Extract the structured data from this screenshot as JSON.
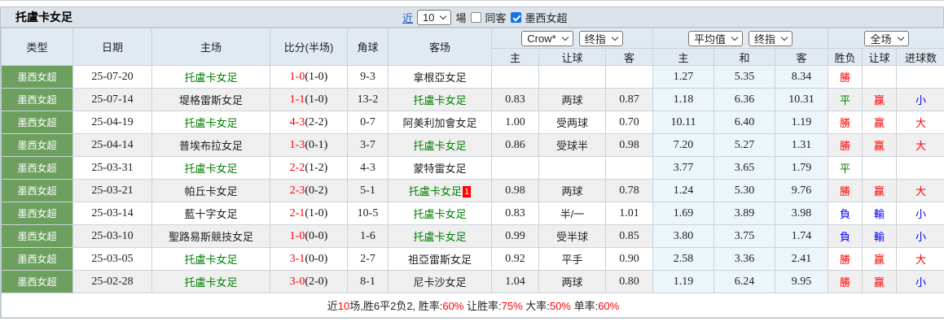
{
  "header": {
    "title": "托盧卡女足",
    "recent_label": "近",
    "recent_count": "10",
    "unit_label": "場",
    "same_away_label": "同客",
    "same_away_checked": false,
    "league_filter_label": "墨西女超",
    "league_filter_checked": true
  },
  "selectors": {
    "bookmaker": "Crow*",
    "bookmaker_stage": "终指",
    "average": "平均值",
    "average_stage": "终指",
    "scope": "全场"
  },
  "columns": {
    "main": [
      "类型",
      "日期",
      "主场",
      "比分(半场)",
      "角球",
      "客场"
    ],
    "sub": [
      "主",
      "让球",
      "客",
      "主",
      "和",
      "客",
      "胜负",
      "让球",
      "进球数"
    ]
  },
  "rows": [
    {
      "league": "墨西女超",
      "date": "25-07-20",
      "home": "托盧卡女足",
      "home_green": true,
      "score_full": "1-0",
      "score_half": "(1-0)",
      "corner": "9-3",
      "away": "拿根亞女足",
      "away_green": false,
      "away_badge": "",
      "odds": [
        "",
        "",
        ""
      ],
      "avg": [
        "1.27",
        "5.35",
        "8.34"
      ],
      "results": [
        {
          "text": "勝",
          "color": "#ff0000"
        },
        {
          "text": "",
          "color": ""
        },
        {
          "text": "",
          "color": ""
        }
      ]
    },
    {
      "league": "墨西女超",
      "date": "25-07-14",
      "home": "堤格雷斯女足",
      "home_green": false,
      "score_full": "1-1",
      "score_half": "(1-0)",
      "corner": "13-2",
      "away": "托盧卡女足",
      "away_green": true,
      "away_badge": "",
      "odds": [
        "0.83",
        "两球",
        "0.87"
      ],
      "avg": [
        "1.18",
        "6.36",
        "10.31"
      ],
      "results": [
        {
          "text": "平",
          "color": "#008000"
        },
        {
          "text": "赢",
          "color": "#ff0000"
        },
        {
          "text": "小",
          "color": "#0000ff"
        }
      ]
    },
    {
      "league": "墨西女超",
      "date": "25-04-19",
      "home": "托盧卡女足",
      "home_green": true,
      "score_full": "4-3",
      "score_half": "(2-2)",
      "corner": "0-7",
      "away": "阿美利加會女足",
      "away_green": false,
      "away_badge": "",
      "odds": [
        "1.00",
        "受两球",
        "0.70"
      ],
      "avg": [
        "10.11",
        "6.40",
        "1.19"
      ],
      "results": [
        {
          "text": "勝",
          "color": "#ff0000"
        },
        {
          "text": "赢",
          "color": "#ff0000"
        },
        {
          "text": "大",
          "color": "#ff0000"
        }
      ]
    },
    {
      "league": "墨西女超",
      "date": "25-04-14",
      "home": "普埃布拉女足",
      "home_green": false,
      "score_full": "1-3",
      "score_half": "(0-1)",
      "corner": "3-7",
      "away": "托盧卡女足",
      "away_green": true,
      "away_badge": "",
      "odds": [
        "0.86",
        "受球半",
        "0.98"
      ],
      "avg": [
        "7.20",
        "5.27",
        "1.31"
      ],
      "results": [
        {
          "text": "勝",
          "color": "#ff0000"
        },
        {
          "text": "赢",
          "color": "#ff0000"
        },
        {
          "text": "大",
          "color": "#ff0000"
        }
      ]
    },
    {
      "league": "墨西女超",
      "date": "25-03-31",
      "home": "托盧卡女足",
      "home_green": true,
      "score_full": "2-2",
      "score_half": "(1-2)",
      "corner": "4-3",
      "away": "蒙特雷女足",
      "away_green": false,
      "away_badge": "",
      "odds": [
        "",
        "",
        ""
      ],
      "avg": [
        "3.77",
        "3.65",
        "1.79"
      ],
      "results": [
        {
          "text": "平",
          "color": "#008000"
        },
        {
          "text": "",
          "color": ""
        },
        {
          "text": "",
          "color": ""
        }
      ]
    },
    {
      "league": "墨西女超",
      "date": "25-03-21",
      "home": "帕丘卡女足",
      "home_green": false,
      "score_full": "2-3",
      "score_half": "(0-2)",
      "corner": "5-1",
      "away": "托盧卡女足",
      "away_green": true,
      "away_badge": "1",
      "odds": [
        "0.98",
        "两球",
        "0.78"
      ],
      "avg": [
        "1.24",
        "5.30",
        "9.76"
      ],
      "results": [
        {
          "text": "勝",
          "color": "#ff0000"
        },
        {
          "text": "赢",
          "color": "#ff0000"
        },
        {
          "text": "大",
          "color": "#ff0000"
        }
      ]
    },
    {
      "league": "墨西女超",
      "date": "25-03-14",
      "home": "藍十字女足",
      "home_green": false,
      "score_full": "2-1",
      "score_half": "(1-0)",
      "corner": "10-5",
      "away": "托盧卡女足",
      "away_green": true,
      "away_badge": "",
      "odds": [
        "0.83",
        "半/一",
        "1.01"
      ],
      "avg": [
        "1.69",
        "3.89",
        "3.98"
      ],
      "results": [
        {
          "text": "負",
          "color": "#0000ff"
        },
        {
          "text": "輸",
          "color": "#0000ff"
        },
        {
          "text": "小",
          "color": "#0000ff"
        }
      ]
    },
    {
      "league": "墨西女超",
      "date": "25-03-10",
      "home": "聖路易斯競技女足",
      "home_green": false,
      "score_full": "1-0",
      "score_half": "(0-0)",
      "corner": "1-6",
      "away": "托盧卡女足",
      "away_green": true,
      "away_badge": "",
      "odds": [
        "0.99",
        "受半球",
        "0.85"
      ],
      "avg": [
        "3.80",
        "3.75",
        "1.74"
      ],
      "results": [
        {
          "text": "負",
          "color": "#0000ff"
        },
        {
          "text": "輸",
          "color": "#0000ff"
        },
        {
          "text": "小",
          "color": "#0000ff"
        }
      ]
    },
    {
      "league": "墨西女超",
      "date": "25-03-05",
      "home": "托盧卡女足",
      "home_green": true,
      "score_full": "3-1",
      "score_half": "(0-0)",
      "corner": "2-7",
      "away": "祖亞雷斯女足",
      "away_green": false,
      "away_badge": "",
      "odds": [
        "0.92",
        "平手",
        "0.90"
      ],
      "avg": [
        "2.58",
        "3.36",
        "2.41"
      ],
      "results": [
        {
          "text": "勝",
          "color": "#ff0000"
        },
        {
          "text": "赢",
          "color": "#ff0000"
        },
        {
          "text": "大",
          "color": "#ff0000"
        }
      ]
    },
    {
      "league": "墨西女超",
      "date": "25-02-28",
      "home": "托盧卡女足",
      "home_green": true,
      "score_full": "3-0",
      "score_half": "(2-0)",
      "corner": "8-1",
      "away": "尼卡沙女足",
      "away_green": false,
      "away_badge": "",
      "odds": [
        "1.04",
        "两球",
        "0.80"
      ],
      "avg": [
        "1.19",
        "6.24",
        "9.95"
      ],
      "results": [
        {
          "text": "勝",
          "color": "#ff0000"
        },
        {
          "text": "赢",
          "color": "#ff0000"
        },
        {
          "text": "小",
          "color": "#0000ff"
        }
      ]
    }
  ],
  "footer": {
    "segments": [
      {
        "text": "近",
        "red": false
      },
      {
        "text": "10",
        "red": true
      },
      {
        "text": "场,胜6平2负2, 胜率:",
        "red": false
      },
      {
        "text": "60%",
        "red": true
      },
      {
        "text": " 让胜率:",
        "red": false
      },
      {
        "text": "75%",
        "red": true
      },
      {
        "text": " 大率:",
        "red": false
      },
      {
        "text": "50%",
        "red": true
      },
      {
        "text": " 单率:",
        "red": false
      },
      {
        "text": "60%",
        "red": true
      }
    ]
  },
  "colors": {
    "league_badge_green": "#6da05f",
    "team_highlight_green": "#008000",
    "score_red": "#ff0000",
    "result_red": "#ff0000",
    "result_green": "#008000",
    "result_blue": "#0000ff",
    "title_bar_bg": "#dce3ea",
    "header_bg": "#e1eaf2",
    "avg_column_bg": "#ebf5fa",
    "stripe_bg": "#efefef",
    "checkbox_checked_blue": "#1673e6"
  }
}
